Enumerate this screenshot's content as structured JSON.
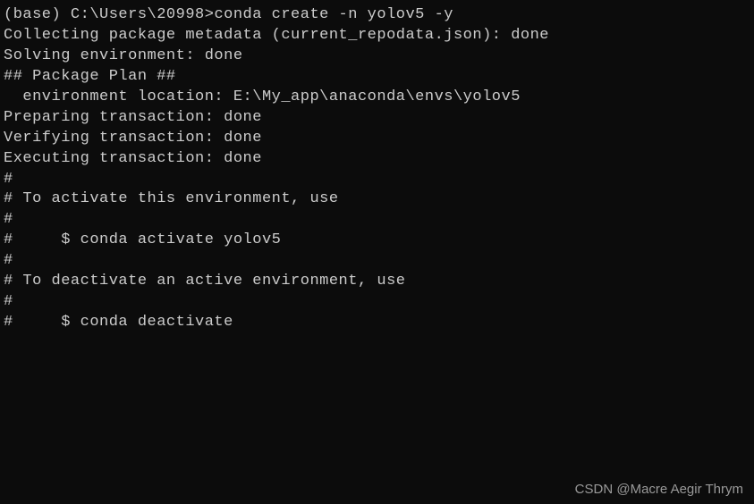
{
  "prompt": {
    "prefix": "(base) C:\\Users\\20998>",
    "command": "conda create -n yolov5 -y"
  },
  "output": {
    "line1": "Collecting package metadata (current_repodata.json): done",
    "line2": "Solving environment: done",
    "blank1": "",
    "heading": "## Package Plan ##",
    "blank2": "",
    "env_location": "  environment location: E:\\My_app\\anaconda\\envs\\yolov5",
    "blank3": "",
    "blank4": "",
    "blank5": "",
    "preparing": "Preparing transaction: done",
    "verifying": "Verifying transaction: done",
    "executing": "Executing transaction: done",
    "hash1": "#",
    "activate_msg": "# To activate this environment, use",
    "hash2": "#",
    "activate_cmd": "#     $ conda activate yolov5",
    "hash3": "#",
    "deactivate_msg": "# To deactivate an active environment, use",
    "hash4": "#",
    "deactivate_cmd": "#     $ conda deactivate"
  },
  "watermark": "CSDN @Macre Aegir Thrym"
}
